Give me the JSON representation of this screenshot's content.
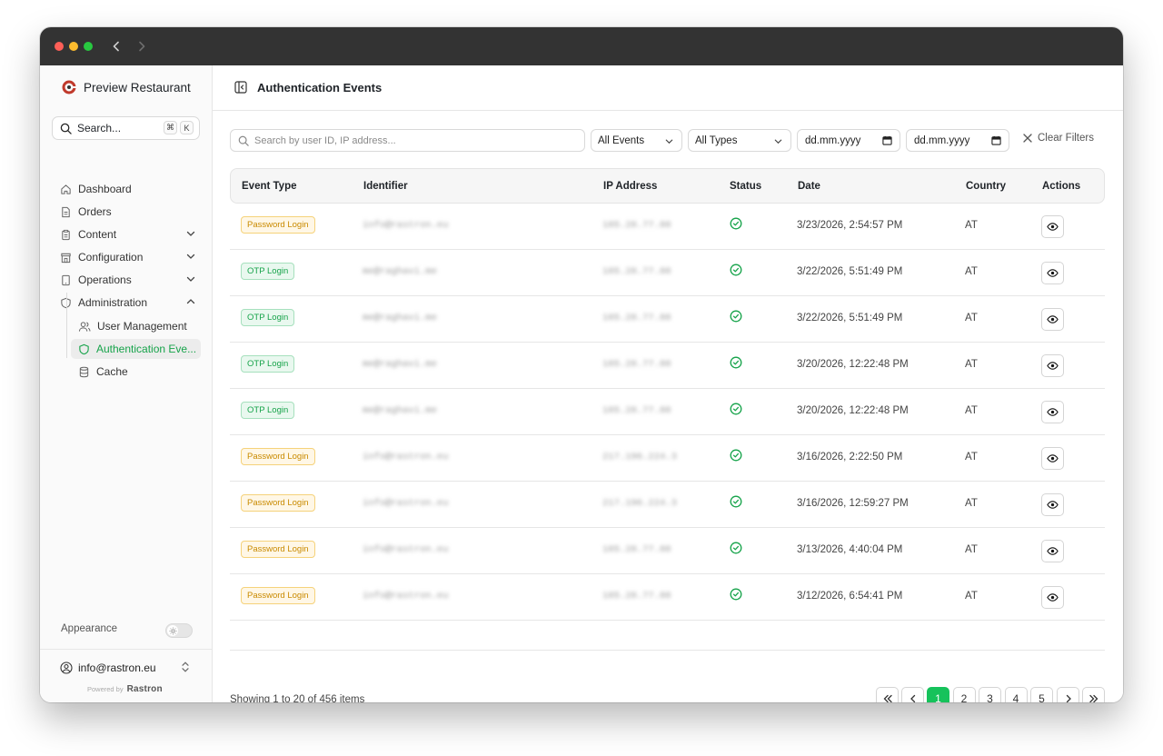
{
  "app": {
    "name": "Preview Restaurant"
  },
  "sidebar": {
    "search": {
      "label": "Search...",
      "kbd_cmd": "⌘",
      "kbd_key": "K"
    },
    "items": [
      {
        "label": "Dashboard",
        "icon": "home-icon"
      },
      {
        "label": "Orders",
        "icon": "document-icon"
      },
      {
        "label": "Content",
        "icon": "clipboard-icon"
      },
      {
        "label": "Configuration",
        "icon": "store-icon"
      },
      {
        "label": "Operations",
        "icon": "tablet-icon"
      },
      {
        "label": "Administration",
        "icon": "shield-icon"
      }
    ],
    "sub_items": [
      {
        "label": "User Management",
        "icon": "users-icon"
      },
      {
        "label": "Authentication Eve...",
        "icon": "shield-icon"
      },
      {
        "label": "Cache",
        "icon": "database-icon"
      }
    ],
    "appearance_label": "Appearance",
    "account_email": "info@rastron.eu",
    "powered_by": "Powered by",
    "powered_brand": "Rastron"
  },
  "header": {
    "title": "Authentication Events"
  },
  "filters": {
    "search_placeholder": "Search by user ID, IP address...",
    "event_select": "All Events",
    "type_select": "All Types",
    "date_from": "dd.mm.yyyy",
    "date_to": "dd.mm.yyyy",
    "clear_label": "Clear Filters"
  },
  "table": {
    "columns": [
      "Event Type",
      "Identifier",
      "IP Address",
      "Status",
      "Date",
      "Country",
      "Actions"
    ],
    "rows": [
      {
        "type": "Password Login",
        "kind": "pw",
        "identifier": "info@rastron.eu",
        "ip": "185.28.77.88",
        "date": "3/23/2026, 2:54:57 PM",
        "country": "AT"
      },
      {
        "type": "OTP Login",
        "kind": "otp",
        "identifier": "me@raghavi.me",
        "ip": "185.28.77.88",
        "date": "3/22/2026, 5:51:49 PM",
        "country": "AT"
      },
      {
        "type": "OTP Login",
        "kind": "otp",
        "identifier": "me@raghavi.me",
        "ip": "185.28.77.88",
        "date": "3/22/2026, 5:51:49 PM",
        "country": "AT"
      },
      {
        "type": "OTP Login",
        "kind": "otp",
        "identifier": "me@raghavi.me",
        "ip": "185.28.77.88",
        "date": "3/20/2026, 12:22:48 PM",
        "country": "AT"
      },
      {
        "type": "OTP Login",
        "kind": "otp",
        "identifier": "me@raghavi.me",
        "ip": "185.28.77.88",
        "date": "3/20/2026, 12:22:48 PM",
        "country": "AT"
      },
      {
        "type": "Password Login",
        "kind": "pw",
        "identifier": "info@rastron.eu",
        "ip": "217.196.224.3",
        "date": "3/16/2026, 2:22:50 PM",
        "country": "AT"
      },
      {
        "type": "Password Login",
        "kind": "pw",
        "identifier": "info@rastron.eu",
        "ip": "217.196.224.3",
        "date": "3/16/2026, 12:59:27 PM",
        "country": "AT"
      },
      {
        "type": "Password Login",
        "kind": "pw",
        "identifier": "info@rastron.eu",
        "ip": "185.28.77.88",
        "date": "3/13/2026, 4:40:04 PM",
        "country": "AT"
      },
      {
        "type": "Password Login",
        "kind": "pw",
        "identifier": "info@rastron.eu",
        "ip": "185.28.77.88",
        "date": "3/12/2026, 6:54:41 PM",
        "country": "AT"
      }
    ]
  },
  "pagination": {
    "summary": "Showing 1 to 20 of 456 items",
    "pages": [
      "1",
      "2",
      "3",
      "4",
      "5"
    ],
    "current": "1"
  },
  "colors": {
    "accent": "#16c25b",
    "password_badge": "#c98a00",
    "otp_badge": "#17a34a"
  }
}
